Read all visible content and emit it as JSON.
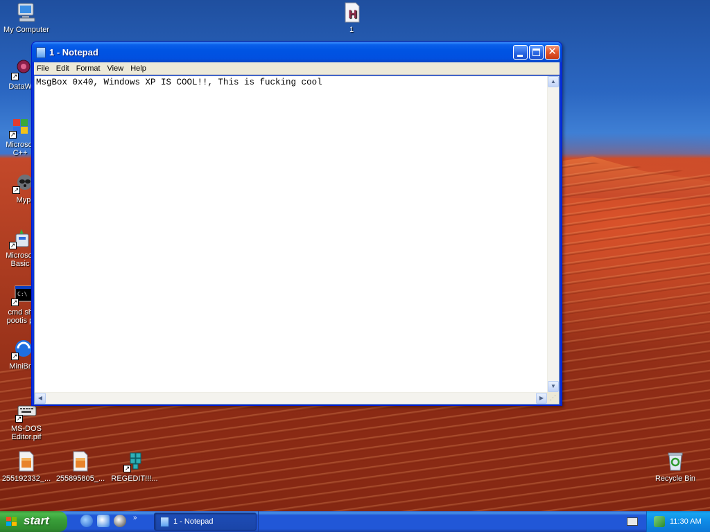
{
  "desktop": {
    "icons": [
      {
        "label": "My Computer"
      },
      {
        "label": "1"
      },
      {
        "label": "DataWa"
      },
      {
        "label": "Microsof C++"
      },
      {
        "label": "Myp"
      },
      {
        "label": "Microsof Basic"
      },
      {
        "label": "cmd shit pootis pe"
      },
      {
        "label": "MiniBro"
      },
      {
        "label": "MS-DOS Editor.pif"
      },
      {
        "label": "255192332_..."
      },
      {
        "label": "255895805_..."
      },
      {
        "label": "REGEDIT!!!..."
      },
      {
        "label": "Recycle Bin"
      }
    ]
  },
  "window": {
    "title": "1 - Notepad",
    "menu": [
      "File",
      "Edit",
      "Format",
      "View",
      "Help"
    ],
    "content": "MsgBox 0x40, Windows XP IS COOL!!, This is fucking cool"
  },
  "taskbar": {
    "start_label": "start",
    "task_label": "1 - Notepad",
    "clock": "11:30 AM",
    "quicklaunch_more": "»"
  },
  "colors": {
    "titlebar": "#0054e3",
    "start_button": "#399f39",
    "taskbar": "#2157d7",
    "tray": "#0f8ae6"
  }
}
